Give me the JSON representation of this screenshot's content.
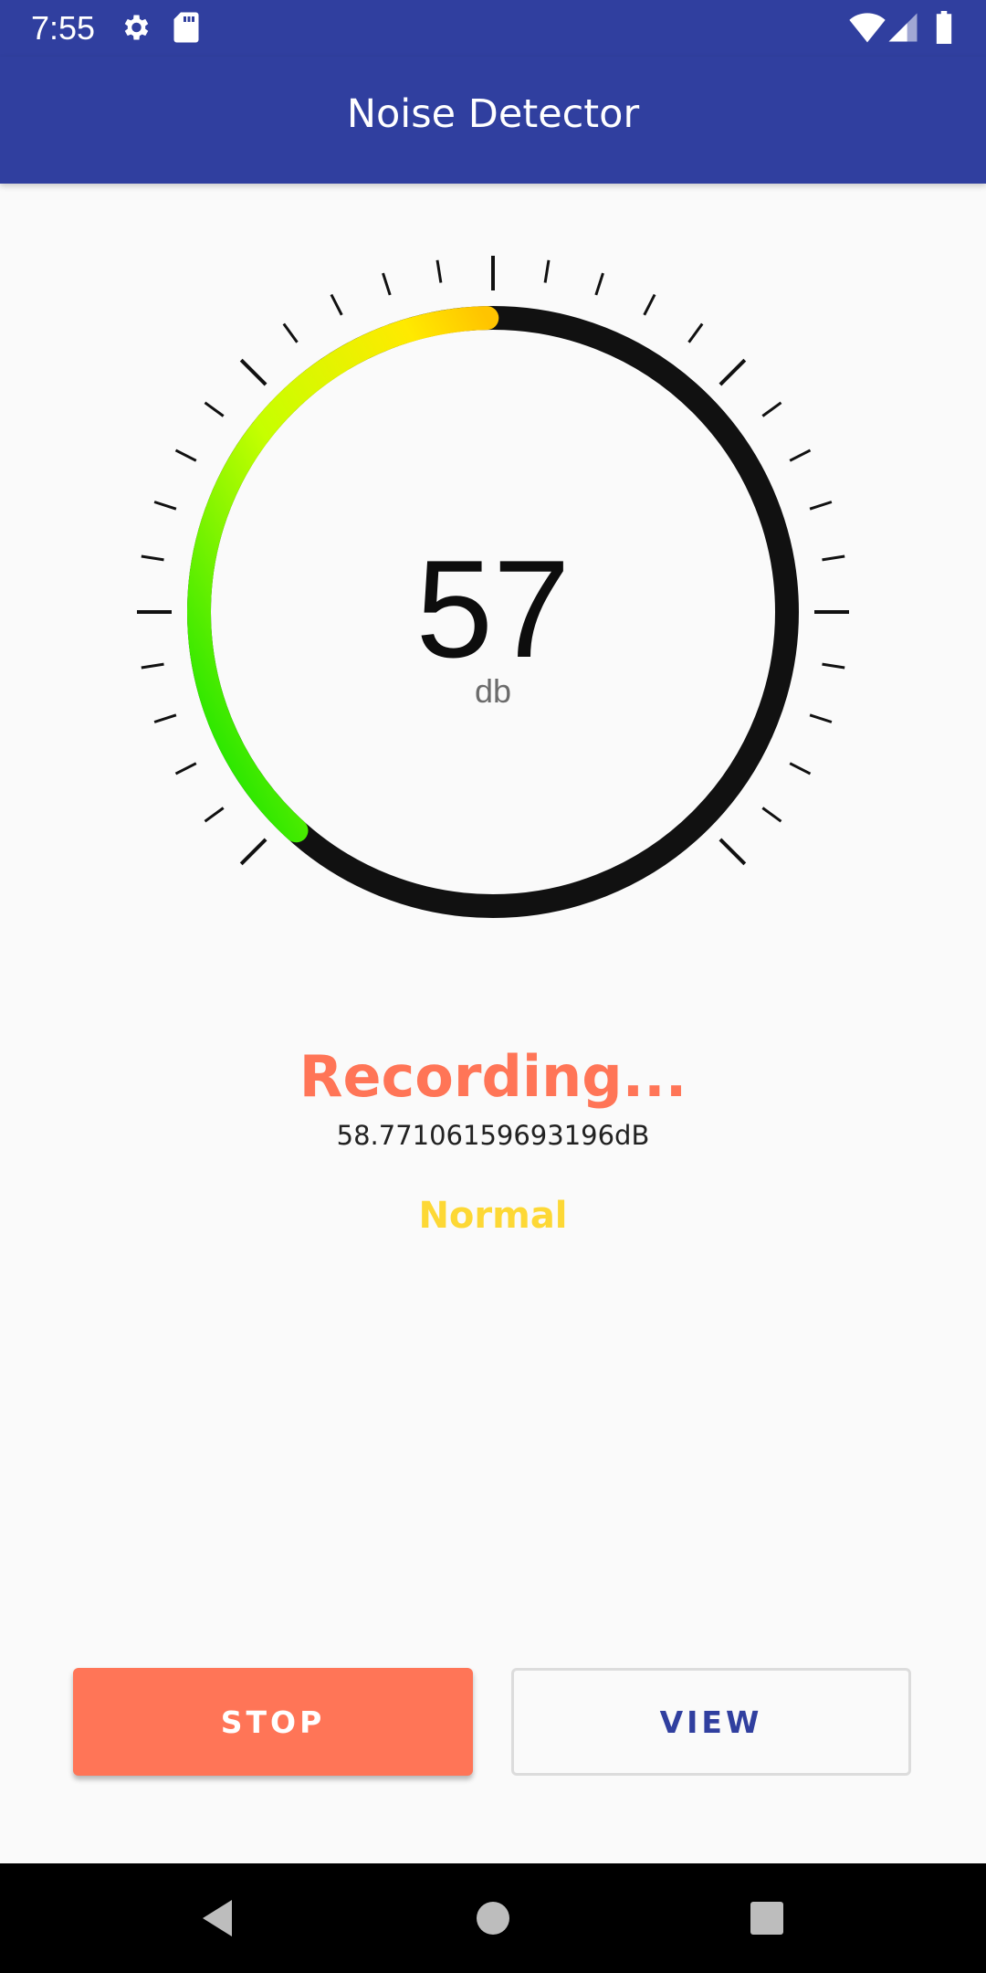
{
  "status_bar": {
    "time": "7:55",
    "left_icons": [
      "gear-icon",
      "sd-card-icon"
    ],
    "right_icons": [
      "wifi-icon",
      "cell-signal-icon",
      "battery-icon"
    ]
  },
  "app_bar": {
    "title": "Noise Detector",
    "color": "#303F9F"
  },
  "gauge": {
    "value": "57",
    "unit": "db",
    "fill_fraction": 0.38,
    "colors": {
      "track": "#111111",
      "low": "#00E000",
      "mid": "#C6FF00",
      "high": "#FFEA00",
      "peak": "#FFC400"
    }
  },
  "status": {
    "recording_text": "Recording...",
    "raw_value_text": "58.77106159693196dB",
    "level_text": "Normal",
    "recording_color": "#FF7557",
    "level_color": "#FDD835"
  },
  "buttons": {
    "stop_label": "STOP",
    "view_label": "VIEW"
  },
  "nav_bar": {
    "items": [
      "back-icon",
      "home-icon",
      "recents-icon"
    ]
  }
}
